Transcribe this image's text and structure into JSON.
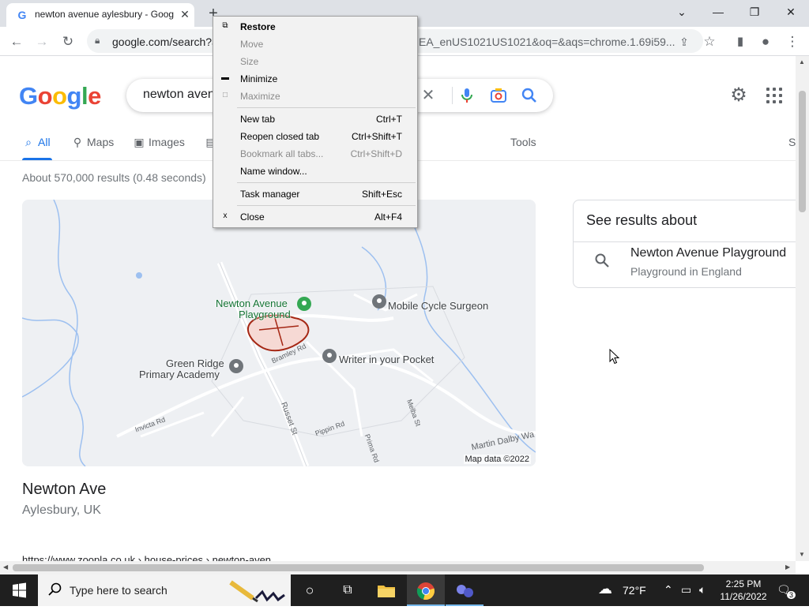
{
  "browser": {
    "tab_title": "newton avenue aylesbury - Goog",
    "tab_close": "✕",
    "new_tab": "+",
    "favicon": "G",
    "url_left": "google.com/search?a",
    "url_right": "EA_enUS1021US1021&oq=&aqs=chrome.1.69i59..."
  },
  "google": {
    "query": "newton aven",
    "tabs": [
      {
        "label": "All",
        "icon": "search-icon"
      },
      {
        "label": "Maps",
        "icon": "map-pin-icon"
      },
      {
        "label": "Images",
        "icon": "image-icon"
      },
      {
        "label": "Tools"
      },
      {
        "label": "S"
      }
    ],
    "result_stats": "About 570,000 results (0.48 seconds)",
    "place_title": "Newton Ave",
    "place_subtitle": "Aylesbury, UK",
    "cite_snippet": "https://www.zoopla.co.uk › house-prices › newton-aven...",
    "map": {
      "labels": [
        "Newton Avenue",
        "Playground",
        "Mobile Cycle Surgeon",
        "Green Ridge",
        "Primary Academy",
        "Writer in your Pocket"
      ],
      "streets": [
        "Bramley Rd",
        "Russet St",
        "Invicta Rd",
        "Pippin Rd",
        "Prima Rd",
        "Melba St",
        "Martin Dalby Wa"
      ],
      "attribution": "Map data ©2022"
    },
    "see_results": {
      "heading": "See results about",
      "item_title": "Newton Avenue Playground",
      "item_subtitle": "Playground in England"
    }
  },
  "context_menu": {
    "items": [
      {
        "label": "Restore",
        "shortcut": "",
        "glyph": "⧉",
        "bold": true,
        "disabled": false
      },
      {
        "label": "Move",
        "shortcut": "",
        "glyph": "",
        "bold": false,
        "disabled": true
      },
      {
        "label": "Size",
        "shortcut": "",
        "glyph": "",
        "bold": false,
        "disabled": true
      },
      {
        "label": "Minimize",
        "shortcut": "",
        "glyph": "▬",
        "bold": false,
        "disabled": false
      },
      {
        "label": "Maximize",
        "shortcut": "",
        "glyph": "□",
        "bold": false,
        "disabled": true
      },
      {
        "label": "New tab",
        "shortcut": "Ctrl+T",
        "glyph": "",
        "bold": false,
        "disabled": false
      },
      {
        "label": "Reopen closed tab",
        "shortcut": "Ctrl+Shift+T",
        "glyph": "",
        "bold": false,
        "disabled": false
      },
      {
        "label": "Bookmark all tabs...",
        "shortcut": "Ctrl+Shift+D",
        "glyph": "",
        "bold": false,
        "disabled": true
      },
      {
        "label": "Name window...",
        "shortcut": "",
        "glyph": "",
        "bold": false,
        "disabled": false
      },
      {
        "label": "Task manager",
        "shortcut": "Shift+Esc",
        "glyph": "",
        "bold": false,
        "disabled": false
      },
      {
        "label": "Close",
        "shortcut": "Alt+F4",
        "glyph": "x",
        "bold": false,
        "disabled": false
      }
    ]
  },
  "taskbar": {
    "search_placeholder": "Type here to search",
    "weather": "72°F",
    "time": "2:25 PM",
    "date": "11/26/2022",
    "notification_count": "3"
  },
  "colors": {
    "accent": "#1a73e8",
    "google_blue": "#4285f4",
    "google_red": "#ea4335",
    "google_yellow": "#fbbc05",
    "google_green": "#34a853"
  }
}
